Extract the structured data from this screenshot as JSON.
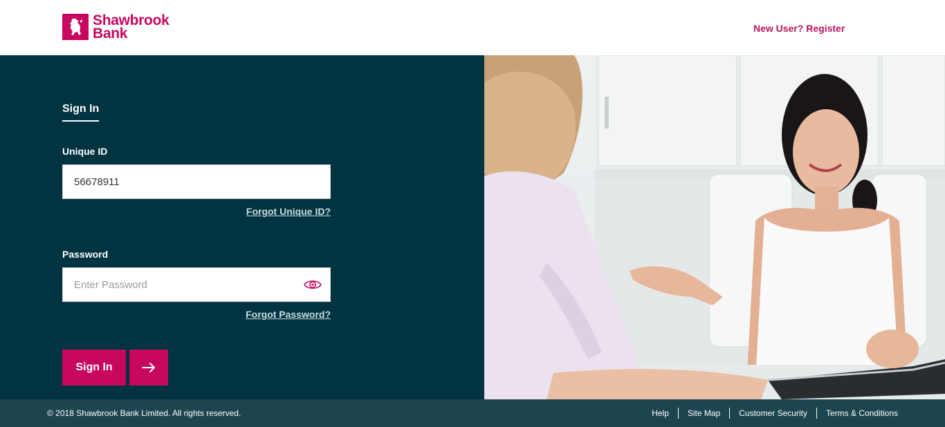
{
  "brand": {
    "name_line1": "Shawbrook",
    "name_line2": "Bank",
    "color": "#c8075f"
  },
  "header": {
    "register_link": "New User? Register"
  },
  "signin": {
    "tab_label": "Sign In",
    "unique_id_label": "Unique ID",
    "unique_id_value": "56678911",
    "forgot_unique_id": "Forgot Unique ID?",
    "password_label": "Password",
    "password_placeholder": "Enter Password",
    "forgot_password": "Forgot Password?",
    "submit_label": "Sign In",
    "submit_arrow_icon": "arrow-right-icon",
    "password_toggle_icon": "eye-icon"
  },
  "footer": {
    "copyright": "© 2018 Shawbrook Bank Limited. All rights reserved.",
    "links": [
      "Help",
      "Site Map",
      "Customer Security",
      "Terms & Conditions"
    ]
  },
  "colors": {
    "panel_bg": "#013340",
    "footer_bg": "#1c4550",
    "accent": "#c8075f"
  }
}
